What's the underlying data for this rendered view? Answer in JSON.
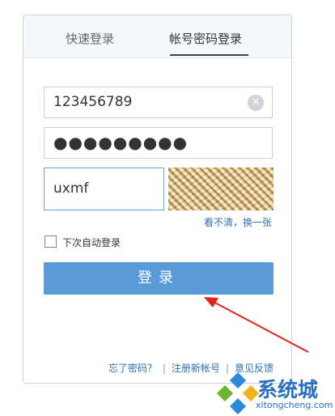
{
  "tabs": [
    {
      "label": "快速登录"
    },
    {
      "label": "帐号密码登录",
      "active": true
    }
  ],
  "username": {
    "value": "123456789"
  },
  "password": {
    "masked_value": "●●●●●●●●●"
  },
  "captcha": {
    "value": "uxmf",
    "refresh_label": "看不清，换一张"
  },
  "remember": {
    "label": "下次自动登录",
    "checked": false
  },
  "login_button": {
    "label": "登录"
  },
  "footer": {
    "forgot": "忘了密码？",
    "register": "注册新帐号",
    "feedback": "意见反馈",
    "separator": "|"
  },
  "watermark": {
    "brand": "系统城",
    "site": "xitongcheng.com"
  },
  "colors": {
    "accent": "#5b9ad8",
    "link": "#2f6fb6",
    "arrow": "#e0241b"
  }
}
